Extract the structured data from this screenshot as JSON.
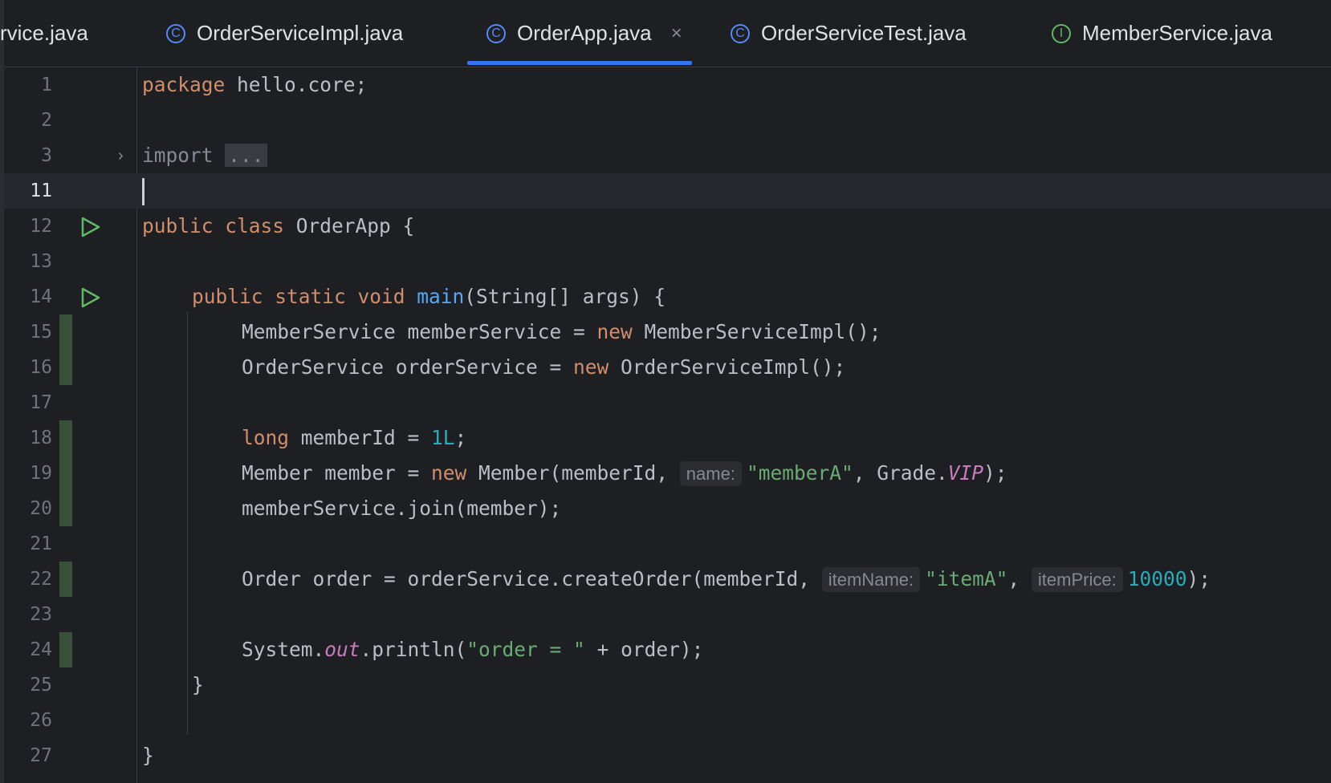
{
  "tabs": [
    {
      "label": "rvice.java",
      "icon": "class-icon",
      "active": false,
      "closable": false
    },
    {
      "label": "OrderServiceImpl.java",
      "icon": "class-icon",
      "active": false,
      "closable": false
    },
    {
      "label": "OrderApp.java",
      "icon": "class-icon",
      "active": true,
      "closable": true
    },
    {
      "label": "OrderServiceTest.java",
      "icon": "class-icon",
      "active": false,
      "closable": false
    },
    {
      "label": "MemberService.java",
      "icon": "interface-icon",
      "active": false,
      "closable": false
    }
  ],
  "icon_letters": {
    "class": "C",
    "interface": "I"
  },
  "close_glyph": "×",
  "editor": {
    "caret_line": "11",
    "lines": [
      {
        "num": "1"
      },
      {
        "num": "2"
      },
      {
        "num": "3"
      },
      {
        "num": "11"
      },
      {
        "num": "12"
      },
      {
        "num": "13"
      },
      {
        "num": "14"
      },
      {
        "num": "15"
      },
      {
        "num": "16"
      },
      {
        "num": "17"
      },
      {
        "num": "18"
      },
      {
        "num": "19"
      },
      {
        "num": "20"
      },
      {
        "num": "21"
      },
      {
        "num": "22"
      },
      {
        "num": "23"
      },
      {
        "num": "24"
      },
      {
        "num": "25"
      },
      {
        "num": "26"
      },
      {
        "num": "27"
      }
    ],
    "code": {
      "l1_kw": "package",
      "l1_rest": " hello.core;",
      "l3_kw": "import",
      "l3_fold": "...",
      "l12_kw": "public class",
      "l12_rest": " OrderApp {",
      "l14_kw": "public static void",
      "l14_fn": "main",
      "l14_rest": "(String[] args) {",
      "l15_a": "MemberService memberService = ",
      "l15_kw": "new",
      "l15_b": " MemberServiceImpl();",
      "l16_a": "OrderService orderService = ",
      "l16_kw": "new",
      "l16_b": " OrderServiceImpl();",
      "l18_kw": "long",
      "l18_a": " memberId = ",
      "l18_num": "1L",
      "l18_b": ";",
      "l19_a": "Member member = ",
      "l19_kw": "new",
      "l19_b": " Member(memberId, ",
      "l19_hint": "name:",
      "l19_str": "\"memberA\"",
      "l19_c": ", Grade.",
      "l19_fld": "VIP",
      "l19_d": ");",
      "l20": "memberService.join(member);",
      "l22_a": "Order order = orderService.createOrder(memberId, ",
      "l22_hint1": "itemName:",
      "l22_str": "\"itemA\"",
      "l22_b": ", ",
      "l22_hint2": "itemPrice:",
      "l22_num": "10000",
      "l22_c": ");",
      "l24_a": "System.",
      "l24_fld": "out",
      "l24_b": ".println(",
      "l24_str": "\"order = \"",
      "l24_c": " + order);",
      "l25": "}",
      "l27": "}"
    }
  }
}
